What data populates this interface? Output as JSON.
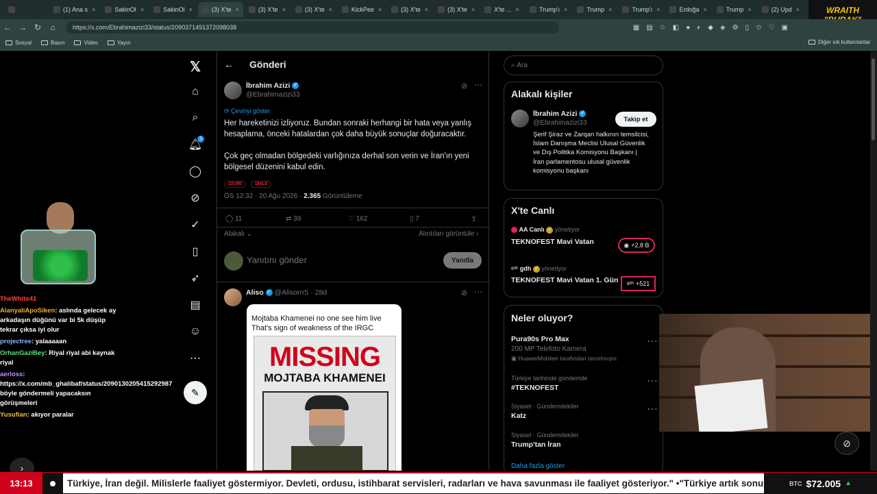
{
  "browser": {
    "tabs": [
      {
        "label": "",
        "icon": "window-icon"
      },
      {
        "label": "(1) Ana s",
        "icon": "x-logo-icon"
      },
      {
        "label": "SakinOl",
        "icon": "video-icon"
      },
      {
        "label": "SakinOl",
        "icon": "video-icon"
      },
      {
        "label": "(3) X'te",
        "icon": "x-logo-icon",
        "active": true
      },
      {
        "label": "(3) X'te",
        "icon": "x-logo-icon"
      },
      {
        "label": "(3) X'te",
        "icon": "x-logo-icon"
      },
      {
        "label": "KickPee",
        "icon": "kick-icon"
      },
      {
        "label": "(3) X'te",
        "icon": "x-logo-icon"
      },
      {
        "label": "(3) X'te",
        "icon": "x-logo-icon"
      },
      {
        "label": "X'te ...",
        "icon": "x-logo-icon"
      },
      {
        "label": "Trump'ı",
        "icon": "news-icon"
      },
      {
        "label": "Trump",
        "icon": "globe-icon"
      },
      {
        "label": "Trump'ı",
        "icon": "news-icon"
      },
      {
        "label": "Erdoğa",
        "icon": "news-icon"
      },
      {
        "label": "Trump",
        "icon": "news-icon"
      },
      {
        "label": "(2) Upd",
        "icon": "news-icon"
      }
    ],
    "url": "https://x.com/Ebrahimazizi33/status/2090371491372098038",
    "bookmarks": [
      "Sosyal",
      "Basın",
      "Video",
      "Yayın"
    ],
    "other_bookmarks": "Diğer sık kullanılanlar",
    "wraith_line1": "WRAITH",
    "wraith_line2": "\"BURAK\""
  },
  "nav": {
    "notification_count": "3"
  },
  "post": {
    "header_title": "Gönderi",
    "author_name": "İbrahim Azizi",
    "author_handle": "@Ebrahimazizi33",
    "translate_label": "Çeviriyi göster",
    "text_p1": "Her hareketinizi izliyoruz. Bundan sonraki herhangi bir hata veya yanlış hesaplama, önceki hatalardan çok daha büyük sonuçlar doğuracaktır.",
    "text_p2": "Çok geç olmadan bölgedeki varlığınıza derhal son verin ve İran'ın yeni bölgesel düzenini kabul edin.",
    "chip_translate": "ÇEVİRİ",
    "chip_listen": "DİNLE",
    "timestamp": "ÖS 12:32 · 20 Ağu 2026 ·",
    "views_count": "2.365",
    "views_label": "Görüntüleme",
    "replies": "11",
    "reposts": "39",
    "likes": "162",
    "bookmarks": "7",
    "relevant_label": "Alakalı",
    "quotes_label": "Alıntıları görüntüle",
    "reply_placeholder": "Yanıtını gönder",
    "reply_button": "Yanıtla"
  },
  "reply": {
    "author_name": "Aliso",
    "author_handle": "@Alisorrr5",
    "age": "· 28d",
    "image_caption": "Mojtaba Khamenei no one see him live\nThat's sign of weakness of the IRGC",
    "missing_title": "MISSING",
    "missing_name": "MOJTABA KHAMENEI"
  },
  "right": {
    "search_placeholder": "Ara",
    "relevant_people": {
      "title": "Alakalı kişiler",
      "name": "İbrahim Azizi",
      "handle": "@Ebrahimazizi33",
      "follow_button": "Takip et",
      "bio": "Şerif Şiraz ve Zarqan halkının temsilcisi, İslam Danışma Meclisi Ulusal Güvenlik ve Dış Politika Komisyonu Başkanı | İran parlamentosu ulusal güvenlik komisyonu başkanı"
    },
    "live": {
      "title": "X'te Canlı",
      "items": [
        {
          "host": "AA Canlı",
          "role": "yönetiyor",
          "title": "TEKNOFEST Mavi Vatan",
          "count": "+2,8 B"
        },
        {
          "host": "gdh",
          "role": "yönetiyor",
          "title": "TEKNOFEST Mavi Vatan 1. Gün",
          "count": "+521"
        }
      ]
    },
    "trends": {
      "title": "Neler oluyor?",
      "items": [
        {
          "title": "Pura90s Pro Max",
          "sub": "200 MP Telefoto Kamera",
          "meta": "HuaweiMobiletr tarafından tanıtılmıştır."
        },
        {
          "context": "Türkiye tarihinde gündemde",
          "title": "#TEKNOFEST"
        },
        {
          "context": "Siyaset · Gündemdekiler",
          "title": "Katz"
        },
        {
          "context": "Siyaset · Gündemdekiler",
          "title": "Trump'tan İran"
        }
      ],
      "more": "Daha fazla göster"
    }
  },
  "chat": [
    {
      "user": "TheWhite41",
      "color": "#ff4040",
      "msg": ""
    },
    {
      "user": "AlanyaliApoSiken",
      "color": "#f0b030",
      "msg": "aslında gelecek ay arkadaşın düğünü var bi 5k düşüp tekrar çıksa iyi olur"
    },
    {
      "user": "projectree",
      "color": "#8fb3ff",
      "msg": "yalaaaaan"
    },
    {
      "user": "OrhanGaziBey",
      "color": "#5fe07a",
      "msg": "Riyal riyal abi kaynak riyal"
    },
    {
      "user": "aerloss",
      "color": "#c58cff",
      "msg": "https://x.com/mb_ghalibaf/status/2090130205415292987 böyle göndermeli yapacaksın görüşmeleri"
    },
    {
      "user": "Yusufian",
      "color": "#f0c040",
      "msg": "akıyor paralar"
    }
  ],
  "ticker": {
    "time": "13:13",
    "text": "Türkiye, İran değil. Milislerle faaliyet göstermiyor. Devleti, ordusu, istihbarat servisleri, radarları ve hava savunması ile faaliyet gösteriyor.\" •\"Türkiye artık sonu",
    "btc_label": "BTC",
    "btc_value": "$72.005"
  }
}
